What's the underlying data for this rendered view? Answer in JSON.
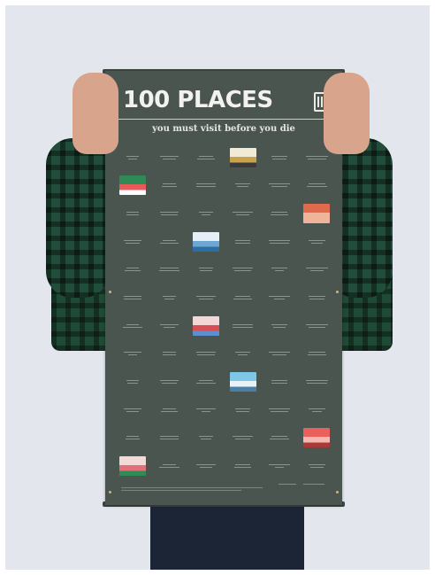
{
  "poster": {
    "title": "100 PLACES",
    "subtitle": "you must visit before you die"
  },
  "grid": {
    "columns": 6,
    "rows": 12,
    "illustrated_cells": [
      {
        "index": 3,
        "name": "desert-illustration",
        "colors": [
          "#f0ead6",
          "#c9a24d",
          "#3a3a3a"
        ]
      },
      {
        "index": 6,
        "name": "forest-illustration",
        "colors": [
          "#2f8a55",
          "#e85a5a",
          "#ffffff"
        ]
      },
      {
        "index": 17,
        "name": "red-tile-illustration",
        "colors": [
          "#e06a4b",
          "#f0b49a"
        ]
      },
      {
        "index": 20,
        "name": "mountain-illustration",
        "colors": [
          "#e7eef5",
          "#6fa7d4",
          "#2d6fa3"
        ]
      },
      {
        "index": 38,
        "name": "city-illustration",
        "colors": [
          "#f3d6d6",
          "#d84e55",
          "#5c8fd0"
        ]
      },
      {
        "index": 51,
        "name": "lake-illustration",
        "colors": [
          "#7fc7e6",
          "#e8f3f8",
          "#4a7fa8"
        ]
      },
      {
        "index": 65,
        "name": "building-illustration",
        "colors": [
          "#e9605c",
          "#f7b8b2",
          "#a83a37"
        ]
      },
      {
        "index": 66,
        "name": "canyon-illustration",
        "colors": [
          "#f4d9d9",
          "#e2707a",
          "#2f8a55"
        ]
      }
    ]
  }
}
